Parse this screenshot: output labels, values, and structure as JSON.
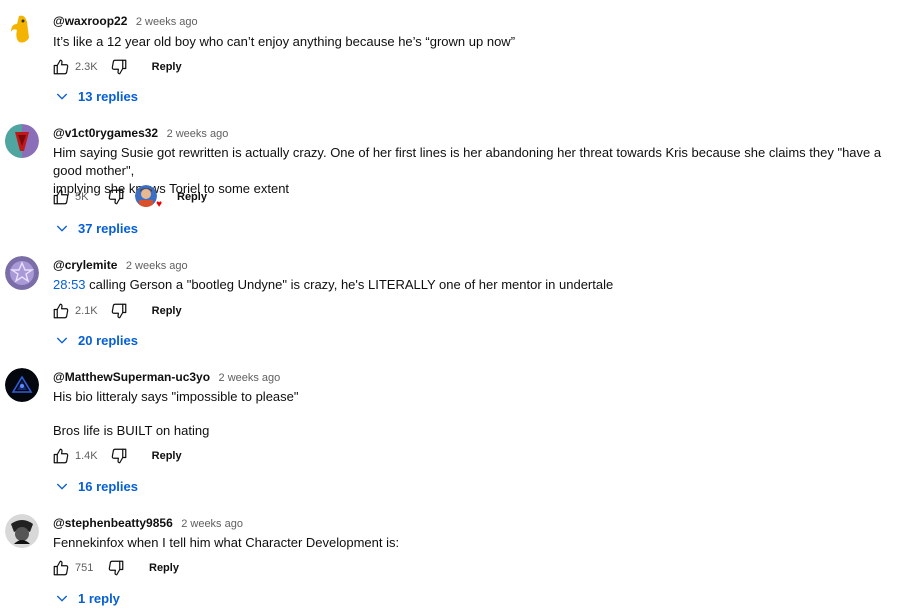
{
  "colors": {
    "link": "#065fd4",
    "meta": "#606060",
    "text": "#0f0f0f"
  },
  "icons": {
    "like": "thumbs-up-icon",
    "dislike": "thumbs-down-icon",
    "expand": "chevron-down-icon"
  },
  "comments": [
    {
      "handle": "@waxroop22",
      "time": "2 weeks ago",
      "lines": [
        "It’s like a 12 year old boy who can’t enjoy anything because he’s “grown up now”"
      ],
      "likes": "2.3K",
      "reply_label": "Reply",
      "replies": "13 replies"
    },
    {
      "handle": "@v1ct0rygames32",
      "time": "2 weeks ago",
      "lines": [
        "Him saying Susie got rewritten is actually crazy. One of her first lines is her abandoning her threat towards Kris because she claims they \"have a good mother\",",
        "implying she knows Toriel to some extent"
      ],
      "likes": "5K",
      "reply_label": "Reply",
      "replies": "37 replies"
    },
    {
      "handle": "@crylemite",
      "time": "2 weeks ago",
      "timestamp_link": "28:53",
      "lines": [
        " calling Gerson a \"bootleg Undyne\" is crazy, he's LITERALLY one of her mentor in undertale"
      ],
      "likes": "2.1K",
      "reply_label": "Reply",
      "replies": "20 replies"
    },
    {
      "handle": "@MatthewSuperman-uc3yo",
      "time": "2 weeks ago",
      "lines": [
        "His bio litteraly says \"impossible to please\"",
        "",
        "Bros life is BUILT on hating"
      ],
      "likes": "1.4K",
      "reply_label": "Reply",
      "replies": "16 replies"
    },
    {
      "handle": "@stephenbeatty9856",
      "time": "2 weeks ago",
      "lines": [
        "Fennekinfox when I tell him what Character Development is:"
      ],
      "likes": "751",
      "reply_label": "Reply",
      "replies": "1 reply"
    }
  ]
}
